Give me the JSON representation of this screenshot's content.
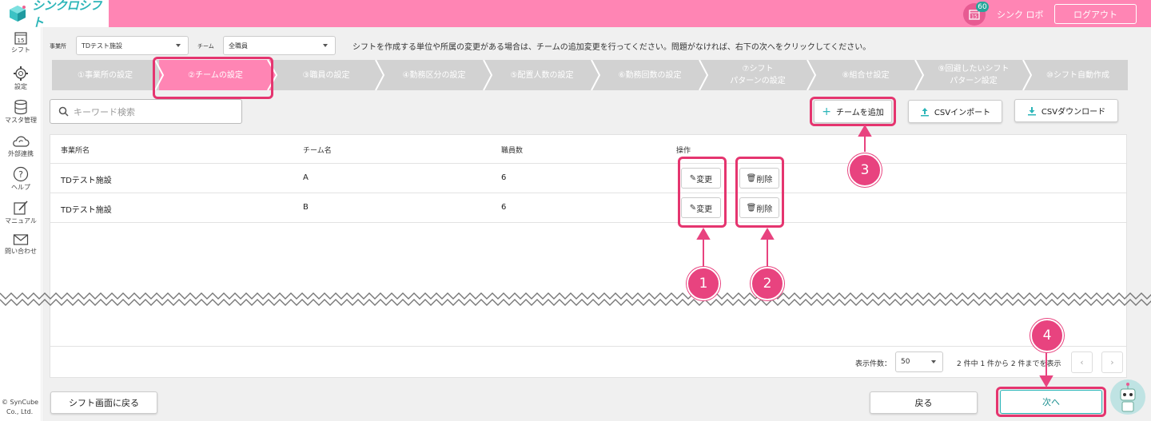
{
  "header": {
    "app_name": "シンクロシフト",
    "badge_count": "60",
    "calendar_day": "15",
    "user_name": "シンク ロボ",
    "logout_label": "ログアウト"
  },
  "sidebar": {
    "items": [
      {
        "label": "シフト",
        "icon": "calendar-icon"
      },
      {
        "label": "設定",
        "icon": "gear-icon"
      },
      {
        "label": "マスタ管理",
        "icon": "database-icon"
      },
      {
        "label": "外部連携",
        "icon": "cloud-sync-icon"
      },
      {
        "label": "ヘルプ",
        "icon": "help-icon"
      },
      {
        "label": "マニュアル",
        "icon": "manual-icon"
      },
      {
        "label": "問い合わせ",
        "icon": "mail-icon"
      }
    ],
    "copyright": [
      "© SynCube",
      "Co., Ltd."
    ]
  },
  "filters": {
    "office_label": "事業所",
    "office_value": "TDテスト施設",
    "team_label": "チーム",
    "team_value": "全職員"
  },
  "instruction": "シフトを作成する単位や所属の変更がある場合は、チームの追加変更を行ってください。問題がなければ、右下の次へをクリックしてください。",
  "steps": [
    {
      "label": "①事業所の設定"
    },
    {
      "label": "②チームの設定",
      "active": true
    },
    {
      "label": "③職員の設定"
    },
    {
      "label": "④勤務区分の設定"
    },
    {
      "label": "⑤配置人数の設定"
    },
    {
      "label": "⑥勤務回数の設定"
    },
    {
      "label": "⑦シフト\nパターンの設定"
    },
    {
      "label": "⑧組合せ設定"
    },
    {
      "label": "⑨回避したいシフト\nパターン設定"
    },
    {
      "label": "⑩シフト自動作成"
    }
  ],
  "toolbar": {
    "search_placeholder": "キーワード検索",
    "add_team_label": "チームを追加",
    "csv_import_label": "CSVインポート",
    "csv_download_label": "CSVダウンロード"
  },
  "table": {
    "headers": [
      "事業所名",
      "チーム名",
      "職員数",
      "操作"
    ],
    "rows": [
      {
        "office": "TDテスト施設",
        "team": "A",
        "count": "6"
      },
      {
        "office": "TDテスト施設",
        "team": "B",
        "count": "6"
      }
    ],
    "edit_label": "変更",
    "delete_label": "削除"
  },
  "pagination": {
    "per_page_label": "表示件数：",
    "per_page_value": "50",
    "summary": "2 件中 1 件から 2 件までを表示",
    "prev": "‹",
    "next": "›"
  },
  "footer": {
    "back_to_shift_label": "シフト画面に戻る",
    "back_label": "戻る",
    "next_label": "次へ"
  },
  "annotations": [
    "1",
    "2",
    "3",
    "4"
  ],
  "colors": {
    "brand_pink": "#ff85b4",
    "highlight": "#e5356f",
    "logo_teal": "#2bb5b8"
  }
}
